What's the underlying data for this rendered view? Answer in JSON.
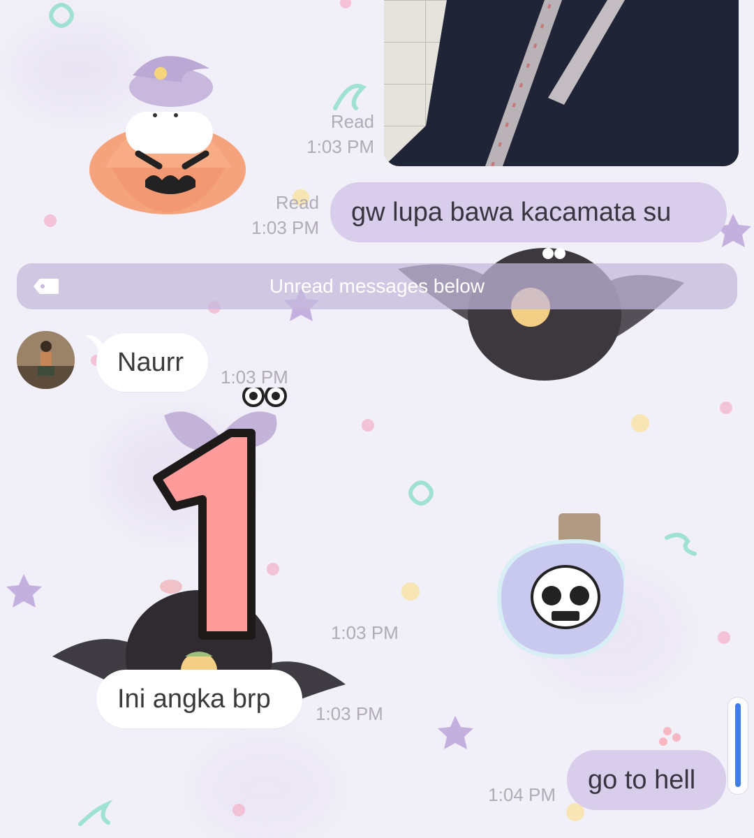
{
  "messages": {
    "photo": {
      "status": "Read",
      "time": "1:03 PM"
    },
    "outgoing_1": {
      "text": "gw lupa bawa kacamata su",
      "status": "Read",
      "time": "1:03 PM"
    },
    "divider": {
      "label": "Unread messages below"
    },
    "incoming_1": {
      "text": "Naurr",
      "time": "1:03 PM"
    },
    "sticker_time": "1:03 PM",
    "incoming_2": {
      "text": "Ini angka brp",
      "time": "1:03 PM"
    },
    "outgoing_2": {
      "text": "go to hell",
      "time": "1:04 PM"
    }
  },
  "sticker": {
    "number": "1"
  },
  "colors": {
    "background": "#f1eff8",
    "outgoing_bubble": "#d8cdea",
    "incoming_bubble": "#ffffff",
    "divider": "#c4b8db",
    "scroll_thumb": "#3f7ee8"
  }
}
